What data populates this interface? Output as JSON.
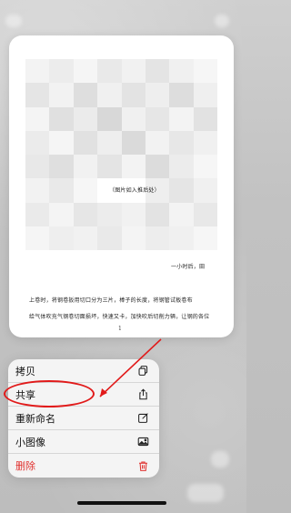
{
  "document_preview": {
    "caption_line": "（图片如入推后处）",
    "side_text": "一小时后，田",
    "lines": [
      "上卷时，将钢卷扳用切口分为三片，棒子的长度，将钢管试板卷布",
      "给气体吹充气钢卷切面损坏，快速又卡，加快吹后切削力辆，让钢的各位"
    ],
    "page_number": "1"
  },
  "context_menu": {
    "items": [
      {
        "label": "拷贝",
        "icon": "copy-icon"
      },
      {
        "label": "共享",
        "icon": "share-icon"
      },
      {
        "label": "重新命名",
        "icon": "rename-icon"
      },
      {
        "label": "小图像",
        "icon": "image-icon"
      },
      {
        "label": "删除",
        "icon": "trash-icon"
      }
    ]
  },
  "colors": {
    "annotation": "#e11a1a",
    "danger": "#e0322f"
  }
}
